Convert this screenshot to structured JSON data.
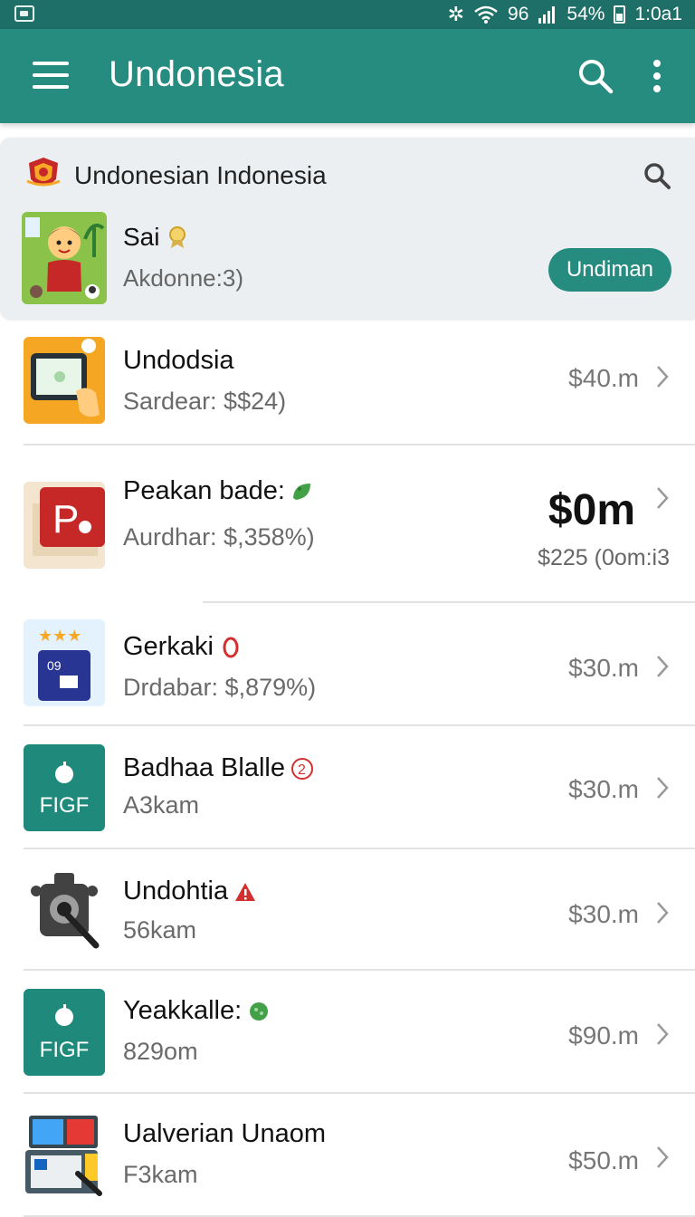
{
  "status_bar": {
    "signal_text": "96",
    "battery": "54%",
    "time": "1:0a1"
  },
  "app_bar": {
    "title": "Undonesia"
  },
  "featured": {
    "title": "Undonesian Indonesia",
    "item_name": "Sai",
    "item_sub": "Akdonne:3)",
    "button_label": "Undiman"
  },
  "items": [
    {
      "name": "Undodsia",
      "sub": "Sardear: $$24)",
      "price": "$40.m",
      "badge": ""
    },
    {
      "name": "Peakan bade:",
      "sub": "Aurdhar: $,358%)",
      "price_big": "$0m",
      "price_small": "$225 (0om:i3",
      "badge": "leaf-icon"
    },
    {
      "name": "Gerkaki",
      "sub": "Drdabar: $,879%)",
      "price": "$30.m",
      "badge": "red-zero-icon"
    },
    {
      "name": "Badhaa Blalle",
      "sub": "A3kam",
      "price": "$30.m",
      "badge": "circled-two-icon",
      "thumb_text": "FIGF"
    },
    {
      "name": "Undohtia",
      "sub": "56kam",
      "price": "$30.m",
      "badge": "warning-triangle-icon"
    },
    {
      "name": "Yeakkalle:",
      "sub": "829om",
      "price": "$90.m",
      "badge": "green-dot-icon",
      "thumb_text": "FIGF"
    },
    {
      "name": "Ualverian Unaom",
      "sub": "F3kam",
      "price": "$50.m",
      "badge": ""
    }
  ],
  "colors": {
    "primary": "#268c80",
    "status_bar": "#1d6f67",
    "card_bg": "#eceff1"
  }
}
